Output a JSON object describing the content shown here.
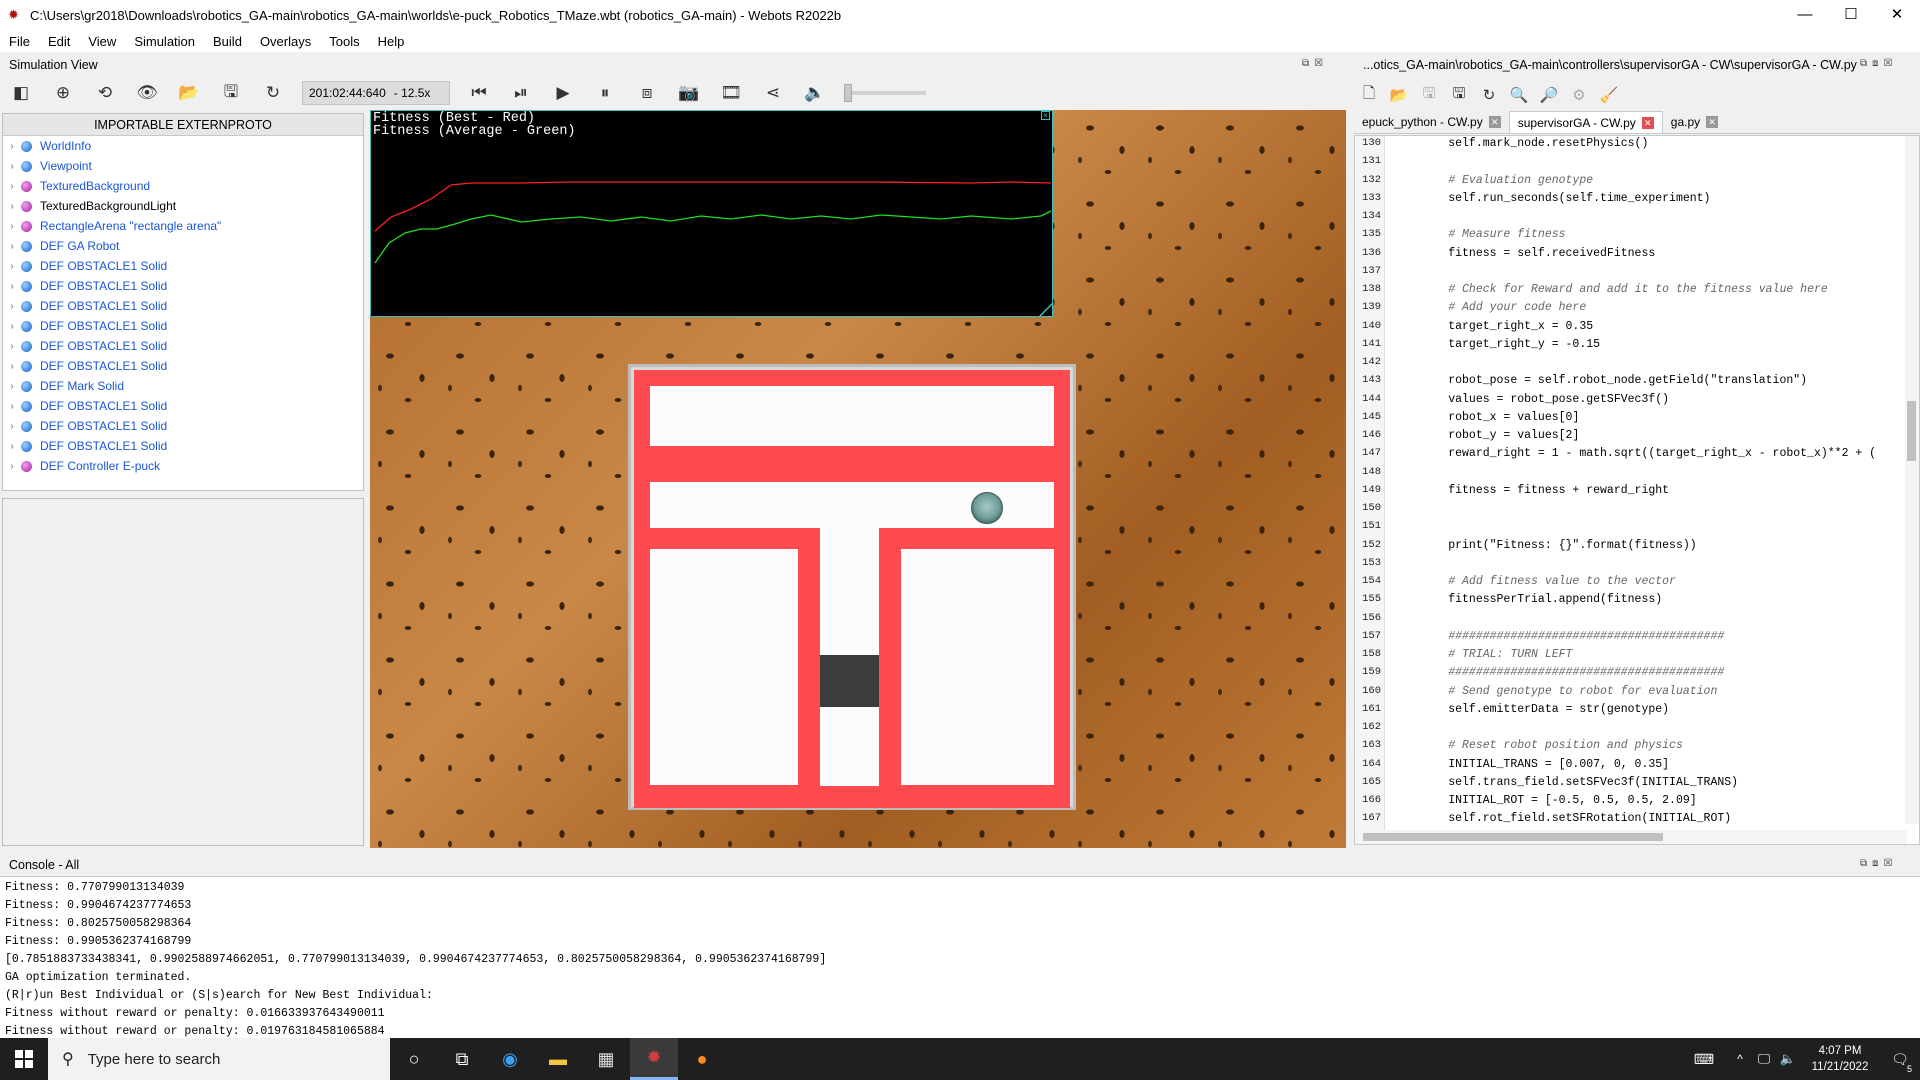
{
  "window": {
    "title": "C:\\Users\\gr2018\\Downloads\\robotics_GA-main\\robotics_GA-main\\worlds\\e-puck_Robotics_TMaze.wbt (robotics_GA-main) - Webots R2022b",
    "controls": [
      "—",
      "☐",
      "✕"
    ]
  },
  "menu": [
    "File",
    "Edit",
    "View",
    "Simulation",
    "Build",
    "Overlays",
    "Tools",
    "Help"
  ],
  "sim_view": {
    "label": "Simulation View",
    "time": "201:02:44:640",
    "speed": "- 12.5x"
  },
  "scene_tree": {
    "header": "IMPORTABLE EXTERNPROTO",
    "nodes": [
      {
        "label": "WorldInfo",
        "ball": "blue",
        "color": "link"
      },
      {
        "label": "Viewpoint",
        "ball": "blue",
        "color": "link"
      },
      {
        "label": "TexturedBackground",
        "ball": "purple",
        "color": "link"
      },
      {
        "label": "TexturedBackgroundLight",
        "ball": "purple",
        "color": "black"
      },
      {
        "label": "RectangleArena \"rectangle arena\"",
        "ball": "purple",
        "color": "link"
      },
      {
        "label": "DEF GA Robot",
        "ball": "blue",
        "color": "link"
      },
      {
        "label": "DEF OBSTACLE1 Solid",
        "ball": "blue",
        "color": "link"
      },
      {
        "label": "DEF OBSTACLE1 Solid",
        "ball": "blue",
        "color": "link"
      },
      {
        "label": "DEF OBSTACLE1 Solid",
        "ball": "blue",
        "color": "link"
      },
      {
        "label": "DEF OBSTACLE1 Solid",
        "ball": "blue",
        "color": "link"
      },
      {
        "label": "DEF OBSTACLE1 Solid",
        "ball": "blue",
        "color": "link"
      },
      {
        "label": "DEF OBSTACLE1 Solid",
        "ball": "blue",
        "color": "link"
      },
      {
        "label": "DEF Mark Solid",
        "ball": "blue",
        "color": "link"
      },
      {
        "label": "DEF OBSTACLE1 Solid",
        "ball": "blue",
        "color": "link"
      },
      {
        "label": "DEF OBSTACLE1 Solid",
        "ball": "blue",
        "color": "link"
      },
      {
        "label": "DEF OBSTACLE1 Solid",
        "ball": "blue",
        "color": "link"
      },
      {
        "label": "DEF Controller E-puck",
        "ball": "purple",
        "color": "link"
      }
    ]
  },
  "fitness_overlay": {
    "line1": "Fitness (Best - Red)",
    "line2": "Fitness (Average - Green)",
    "best_color": "#ff2020",
    "avg_color": "#20e020"
  },
  "editor": {
    "path": "...otics_GA-main\\robotics_GA-main\\controllers\\supervisorGA - CW\\supervisorGA - CW.py",
    "tabs": [
      {
        "label": "epuck_python - CW.py",
        "active": false
      },
      {
        "label": "supervisorGA - CW.py",
        "active": true
      },
      {
        "label": "ga.py",
        "active": false
      }
    ],
    "lines": [
      {
        "n": "130",
        "t": "        self.mark_node.resetPhysics()",
        "k": "code"
      },
      {
        "n": "131",
        "t": "",
        "k": "code"
      },
      {
        "n": "132",
        "t": "        # Evaluation genotype",
        "k": "comment"
      },
      {
        "n": "133",
        "t": "        self.run_seconds(self.time_experiment)",
        "k": "code"
      },
      {
        "n": "134",
        "t": "",
        "k": "code"
      },
      {
        "n": "135",
        "t": "        # Measure fitness",
        "k": "comment"
      },
      {
        "n": "136",
        "t": "        fitness = self.receivedFitness",
        "k": "code"
      },
      {
        "n": "137",
        "t": "",
        "k": "code"
      },
      {
        "n": "138",
        "t": "        # Check for Reward and add it to the fitness value here",
        "k": "comment"
      },
      {
        "n": "139",
        "t": "        # Add your code here",
        "k": "comment"
      },
      {
        "n": "140",
        "t": "        target_right_x = 0.35",
        "k": "code"
      },
      {
        "n": "141",
        "t": "        target_right_y = -0.15",
        "k": "code"
      },
      {
        "n": "142",
        "t": "",
        "k": "code"
      },
      {
        "n": "143",
        "t": "        robot_pose = self.robot_node.getField(\"translation\")",
        "k": "code"
      },
      {
        "n": "144",
        "t": "        values = robot_pose.getSFVec3f()",
        "k": "code"
      },
      {
        "n": "145",
        "t": "        robot_x = values[0]",
        "k": "code"
      },
      {
        "n": "146",
        "t": "        robot_y = values[2]",
        "k": "code"
      },
      {
        "n": "147",
        "t": "        reward_right = 1 - math.sqrt((target_right_x - robot_x)**2 + (",
        "k": "code"
      },
      {
        "n": "148",
        "t": "",
        "k": "code"
      },
      {
        "n": "149",
        "t": "        fitness = fitness + reward_right",
        "k": "code"
      },
      {
        "n": "150",
        "t": "",
        "k": "code"
      },
      {
        "n": "151",
        "t": "",
        "k": "code"
      },
      {
        "n": "152",
        "t": "        print(\"Fitness: {}\".format(fitness))",
        "k": "code"
      },
      {
        "n": "153",
        "t": "",
        "k": "code"
      },
      {
        "n": "154",
        "t": "        # Add fitness value to the vector",
        "k": "comment"
      },
      {
        "n": "155",
        "t": "        fitnessPerTrial.append(fitness)",
        "k": "code"
      },
      {
        "n": "156",
        "t": "",
        "k": "code"
      },
      {
        "n": "157",
        "t": "        ########################################",
        "k": "comment"
      },
      {
        "n": "158",
        "t": "        # TRIAL: TURN LEFT",
        "k": "comment"
      },
      {
        "n": "159",
        "t": "        ########################################",
        "k": "comment"
      },
      {
        "n": "160",
        "t": "        # Send genotype to robot for evaluation",
        "k": "comment"
      },
      {
        "n": "161",
        "t": "        self.emitterData = str(genotype)",
        "k": "code"
      },
      {
        "n": "162",
        "t": "",
        "k": "code"
      },
      {
        "n": "163",
        "t": "        # Reset robot position and physics",
        "k": "comment"
      },
      {
        "n": "164",
        "t": "        INITIAL_TRANS = [0.007, 0, 0.35]",
        "k": "code"
      },
      {
        "n": "165",
        "t": "        self.trans_field.setSFVec3f(INITIAL_TRANS)",
        "k": "code"
      },
      {
        "n": "166",
        "t": "        INITIAL_ROT = [-0.5, 0.5, 0.5, 2.09]",
        "k": "code"
      },
      {
        "n": "167",
        "t": "        self.rot_field.setSFRotation(INITIAL_ROT)",
        "k": "code"
      }
    ]
  },
  "console": {
    "label": "Console - All",
    "lines": [
      "Fitness: 0.770799013134039",
      "Fitness: 0.9904674237774653",
      "Fitness: 0.8025750058298364",
      "Fitness: 0.9905362374168799",
      "[0.7851883733438341, 0.9902588974662051, 0.770799013134039, 0.9904674237774653, 0.8025750058298364, 0.9905362374168799]",
      "GA optimization terminated.",
      "(R|r)un Best Individual or (S|s)earch for New Best Individual:",
      "Fitness without reward or penalty: 0.016633937643490011",
      "Fitness without reward or penalty: 0.019763184581065884"
    ]
  },
  "taskbar": {
    "search_placeholder": "Type here to search",
    "time": "4:07 PM",
    "date": "11/21/2022",
    "notif_count": "5"
  }
}
